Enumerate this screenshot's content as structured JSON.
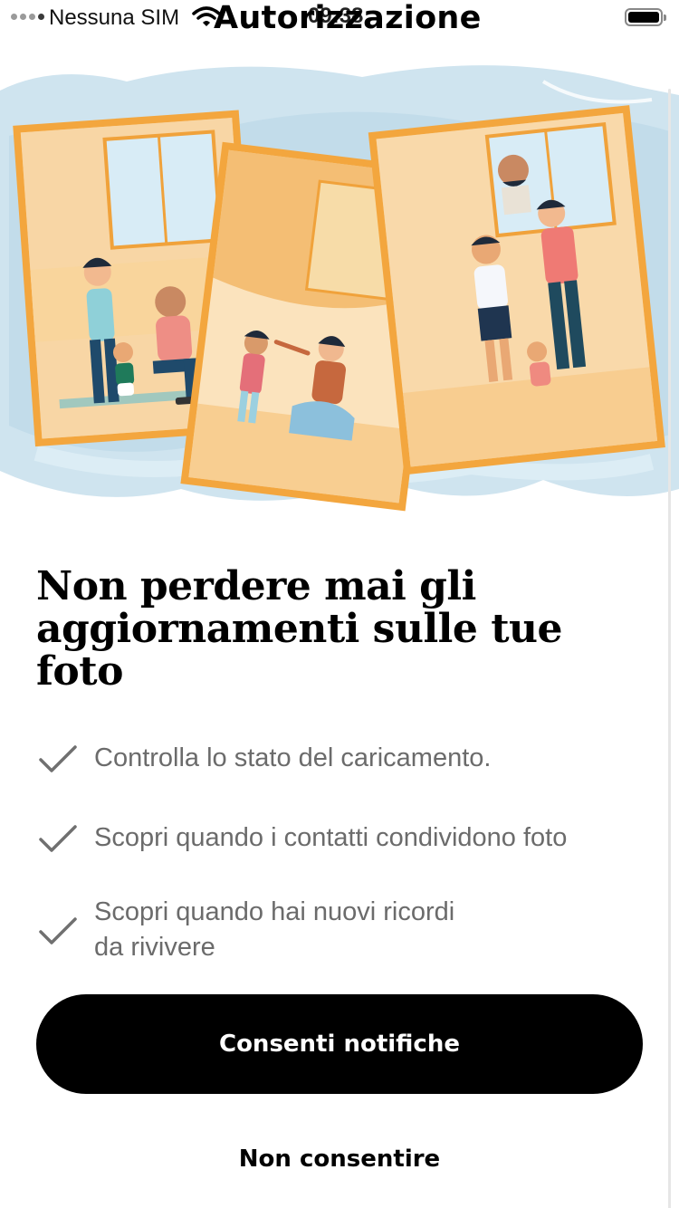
{
  "status_bar": {
    "carrier": "Nessuna SIM",
    "time": "09:38",
    "signal_icon": "signal-dots-icon",
    "wifi_icon": "wifi-icon",
    "battery_icon": "battery-full-icon"
  },
  "nav": {
    "title": "Autorizzazione"
  },
  "hero": {
    "illustration": "family-photo-collage-illustration"
  },
  "content": {
    "headline_lines": [
      "Non perdere mai gli",
      "aggiornamenti sulle tue",
      "foto"
    ],
    "features": [
      {
        "icon": "checkmark-icon",
        "lines": [
          "Controlla lo stato del caricamento."
        ]
      },
      {
        "icon": "checkmark-icon",
        "lines": [
          "Scopri quando i contatti condividono foto"
        ]
      },
      {
        "icon": "checkmark-icon",
        "lines": [
          "Scopri quando hai nuovi ricordi",
          "da rivivere"
        ]
      }
    ]
  },
  "actions": {
    "primary_label": "Consenti notifiche",
    "secondary_label": "Non consentire"
  },
  "colors": {
    "primary_button_bg": "#000000",
    "primary_button_text": "#ffffff",
    "body_text": "#6b6b6b",
    "heading_text": "#000000",
    "watercolor_blue": "#c9e1ee",
    "illustration_orange": "#f0a23b"
  }
}
